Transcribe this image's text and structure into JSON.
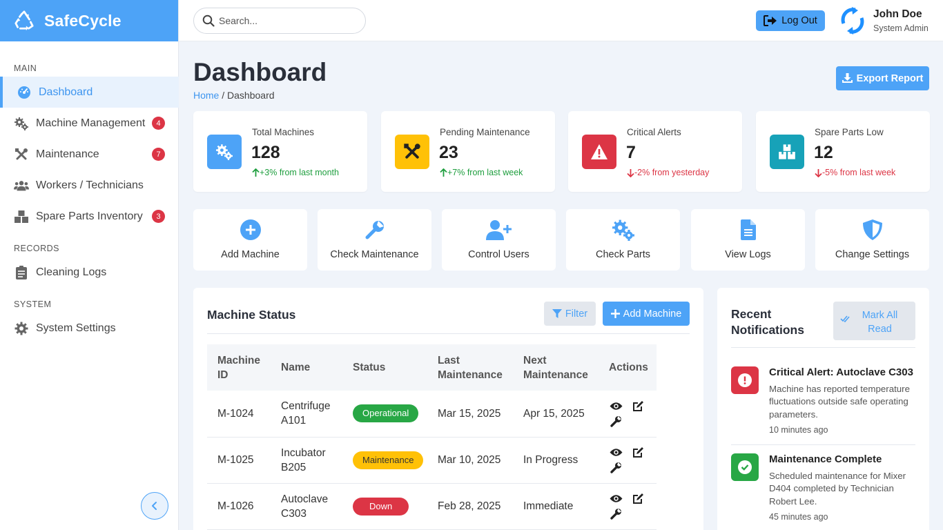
{
  "brand": {
    "name": "SafeCycle"
  },
  "sidebar": {
    "sections": {
      "main": "MAIN",
      "records": "RECORDS",
      "system": "SYSTEM"
    },
    "items": [
      {
        "label": "Dashboard",
        "icon": "tachometer-icon",
        "active": true
      },
      {
        "label": "Machine Management",
        "icon": "cogs-icon",
        "badge": "4"
      },
      {
        "label": "Maintenance",
        "icon": "tools-icon",
        "badge": "7"
      },
      {
        "label": "Workers / Technicians",
        "icon": "users-icon"
      },
      {
        "label": "Spare Parts Inventory",
        "icon": "boxes-icon",
        "badge": "3"
      },
      {
        "label": "Cleaning Logs",
        "icon": "clipboard-icon"
      },
      {
        "label": "System Settings",
        "icon": "gear-icon"
      }
    ]
  },
  "topbar": {
    "search_placeholder": "Search...",
    "logout_label": "Log Out",
    "user": {
      "name": "John Doe",
      "role": "System Admin"
    }
  },
  "page": {
    "title": "Dashboard",
    "breadcrumb": {
      "home": "Home",
      "separator": " / ",
      "current": "Dashboard"
    },
    "export_label": "Export Report"
  },
  "stats": [
    {
      "label": "Total Machines",
      "value": "128",
      "change": "+3% from last month",
      "trend": "up",
      "color": "#4da3f7",
      "icon": "cogs-icon"
    },
    {
      "label": "Pending Maintenance",
      "value": "23",
      "change": "+7% from last week",
      "trend": "up",
      "color": "#ffc107",
      "icon": "tools-icon"
    },
    {
      "label": "Critical Alerts",
      "value": "7",
      "change": "-2% from yesterday",
      "trend": "down",
      "color": "#dc3545",
      "icon": "warning-icon"
    },
    {
      "label": "Spare Parts Low",
      "value": "12",
      "change": "-5% from last week",
      "trend": "down",
      "color": "#17a2b8",
      "icon": "boxes-icon"
    }
  ],
  "quick_actions": [
    {
      "label": "Add Machine",
      "icon": "plus-circle-icon"
    },
    {
      "label": "Check Maintenance",
      "icon": "wrench-icon"
    },
    {
      "label": "Control Users",
      "icon": "user-plus-icon"
    },
    {
      "label": "Check Parts",
      "icon": "cogs-icon"
    },
    {
      "label": "View Logs",
      "icon": "file-icon"
    },
    {
      "label": "Change Settings",
      "icon": "shield-icon"
    }
  ],
  "machine_status": {
    "title": "Machine Status",
    "filter_label": "Filter",
    "add_label": "Add Machine",
    "columns": [
      "Machine ID",
      "Name",
      "Status",
      "Last Maintenance",
      "Next Maintenance",
      "Actions"
    ],
    "rows": [
      {
        "id": "M-1024",
        "name": "Centrifuge A101",
        "status": "Operational",
        "status_type": "op",
        "last": "Mar 15, 2025",
        "next": "Apr 15, 2025"
      },
      {
        "id": "M-1025",
        "name": "Incubator B205",
        "status": "Maintenance",
        "status_type": "mn",
        "last": "Mar 10, 2025",
        "next": "In Progress"
      },
      {
        "id": "M-1026",
        "name": "Autoclave C303",
        "status": "Down",
        "status_type": "dn",
        "last": "Feb 28, 2025",
        "next": "Immediate"
      }
    ]
  },
  "notifications": {
    "title": "Recent Notifications",
    "mark_all_label": "Mark All Read",
    "items": [
      {
        "title": "Critical Alert: Autoclave C303",
        "body": "Machine has reported temperature fluctuations outside safe operating parameters.",
        "time": "10 minutes ago",
        "color": "#dc3545",
        "icon": "exclamation-circle-icon"
      },
      {
        "title": "Maintenance Complete",
        "body": "Scheduled maintenance for Mixer D404 completed by Technician Robert Lee.",
        "time": "45 minutes ago",
        "color": "#28a745",
        "icon": "check-circle-icon"
      }
    ]
  },
  "colors": {
    "primary": "#4da3f7",
    "success": "#28a745",
    "warning": "#ffc107",
    "danger": "#dc3545",
    "info": "#17a2b8"
  }
}
